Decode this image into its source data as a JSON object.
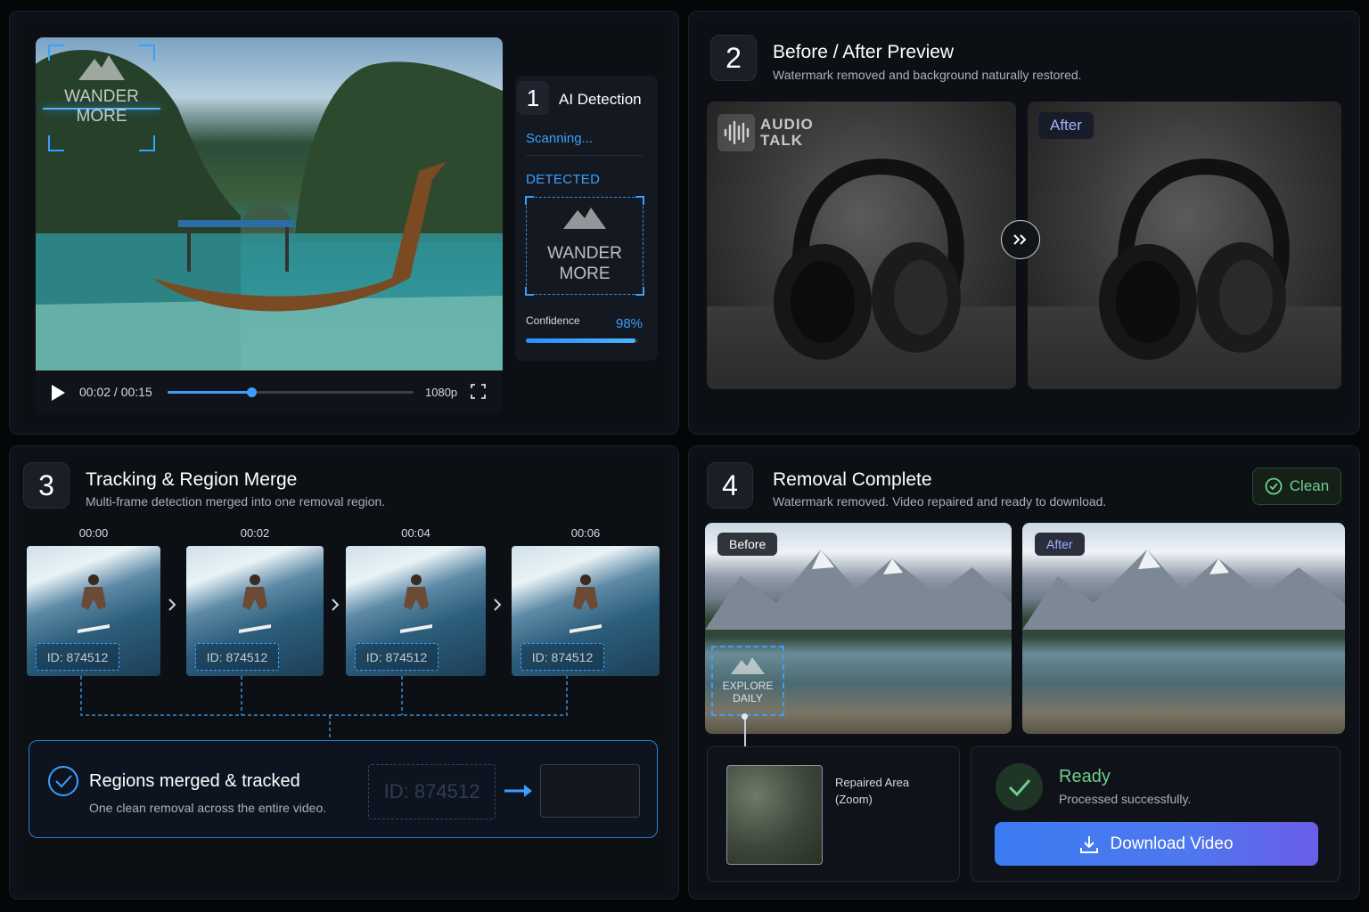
{
  "panel1": {
    "player": {
      "time": "00:02 / 00:15",
      "quality": "1080p",
      "progress": 0.34
    },
    "watermark": {
      "line1": "WANDER",
      "line2": "MORE"
    },
    "detection": {
      "step": "1",
      "title": "AI Detection",
      "scanning": "Scanning...",
      "detected_label": "DETECTED",
      "confidence_label": "Confidence",
      "confidence_value": "98%",
      "confidence_level": 0.98
    }
  },
  "panel2": {
    "step": "2",
    "title": "Before / After Preview",
    "subtitle": "Watermark removed and background naturally restored.",
    "after_label": "After",
    "watermark": {
      "line1": "AUDIO",
      "line2": "TALK"
    }
  },
  "panel3": {
    "step": "3",
    "title": "Tracking & Region Merge",
    "subtitle": "Multi-frame detection merged into one removal region.",
    "frames": [
      {
        "time": "00:00",
        "id": "ID: 874512"
      },
      {
        "time": "00:02",
        "id": "ID: 874512"
      },
      {
        "time": "00:04",
        "id": "ID: 874512"
      },
      {
        "time": "00:06",
        "id": "ID: 874512"
      }
    ],
    "merged": {
      "title": "Regions merged & tracked",
      "subtitle": "One clean removal across the entire video.",
      "id": "ID: 874512"
    }
  },
  "panel4": {
    "step": "4",
    "title": "Removal Complete",
    "subtitle": "Watermark removed. Video repaired and ready to download.",
    "badge": "Clean",
    "before_label": "Before",
    "after_label": "After",
    "watermark": {
      "line1": "EXPLORE",
      "line2": "DAILY"
    },
    "zoom_label_1": "Repaired Area",
    "zoom_label_2": "(Zoom)",
    "ready_title": "Ready",
    "ready_sub": "Processed successfully.",
    "download_label": "Download Video"
  },
  "colors": {
    "accent": "#3aa0ff",
    "ready": "#6fd08c",
    "button": "#3b7cf2"
  }
}
